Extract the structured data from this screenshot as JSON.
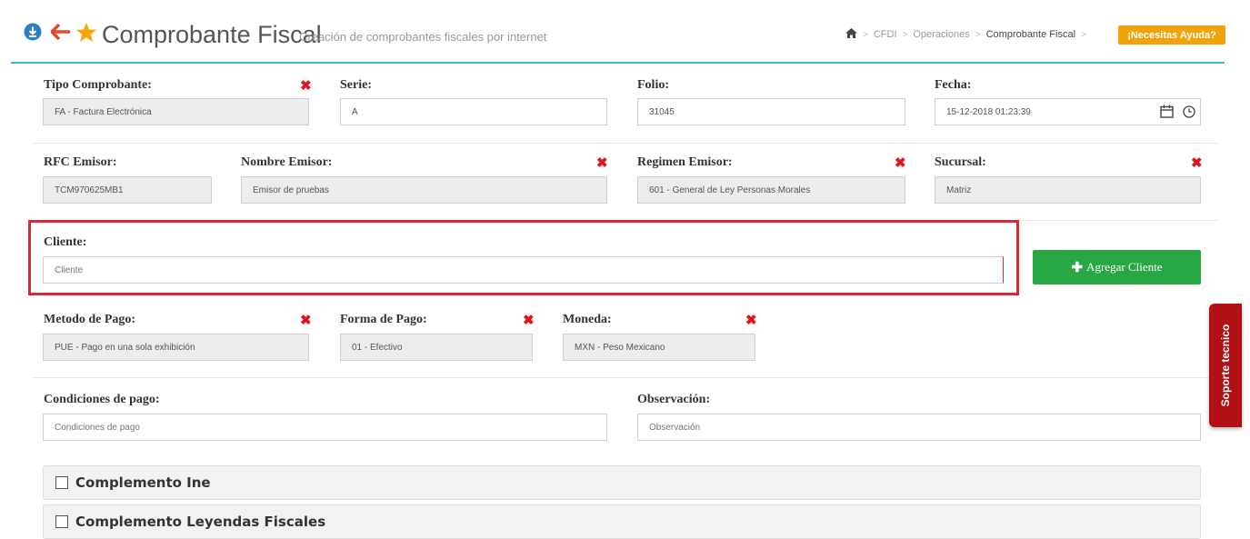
{
  "header": {
    "title": "Comprobante Fiscal",
    "subtitle": "Creación de comprobantes fiscales por internet",
    "breadcrumb": [
      "CFDI",
      "Operaciones",
      "Comprobante Fiscal"
    ],
    "help_label": "¡Necesitas Ayuda?",
    "icons": [
      "download-circle-icon",
      "back-arrow-icon",
      "star-icon",
      "home-icon"
    ]
  },
  "row1": {
    "tipo_label": "Tipo Comprobante:",
    "tipo_value": "FA - Factura Electrónica",
    "serie_label": "Serie:",
    "serie_value": "A",
    "folio_label": "Folio:",
    "folio_value": "31045",
    "fecha_label": "Fecha:",
    "fecha_value": "15-12-2018 01:23:39"
  },
  "row2": {
    "rfc_label": "RFC Emisor:",
    "rfc_value": "TCM970625MB1",
    "nombre_label": "Nombre Emisor:",
    "nombre_value": "Emisor de pruebas",
    "regimen_label": "Regimen Emisor:",
    "regimen_value": "601 - General de Ley Personas Morales",
    "sucursal_label": "Sucursal:",
    "sucursal_value": "Matriz"
  },
  "cliente": {
    "label": "Cliente:",
    "placeholder": "Cliente",
    "add_label": "Agregar Cliente"
  },
  "row3": {
    "metodo_label": "Metodo de Pago:",
    "metodo_value": "PUE - Pago en una sola exhibición",
    "forma_label": "Forma de Pago:",
    "forma_value": "01 - Efectivo",
    "moneda_label": "Moneda:",
    "moneda_value": "MXN - Peso Mexicano"
  },
  "row4": {
    "condiciones_label": "Condiciones de pago:",
    "condiciones_placeholder": "Condiciones de pago",
    "observacion_label": "Observación:",
    "observacion_placeholder": "Observación"
  },
  "panels": [
    "Complemento Ine",
    "Complemento Leyendas Fiscales"
  ],
  "side_tab": "Soporte tecnico",
  "colors": {
    "accent": "#3cb4d8",
    "help": "#f0a30a",
    "add_button": "#27a844",
    "highlight": "#d42b35",
    "side_tab": "#b01016",
    "required_mark": "#e0141b"
  }
}
